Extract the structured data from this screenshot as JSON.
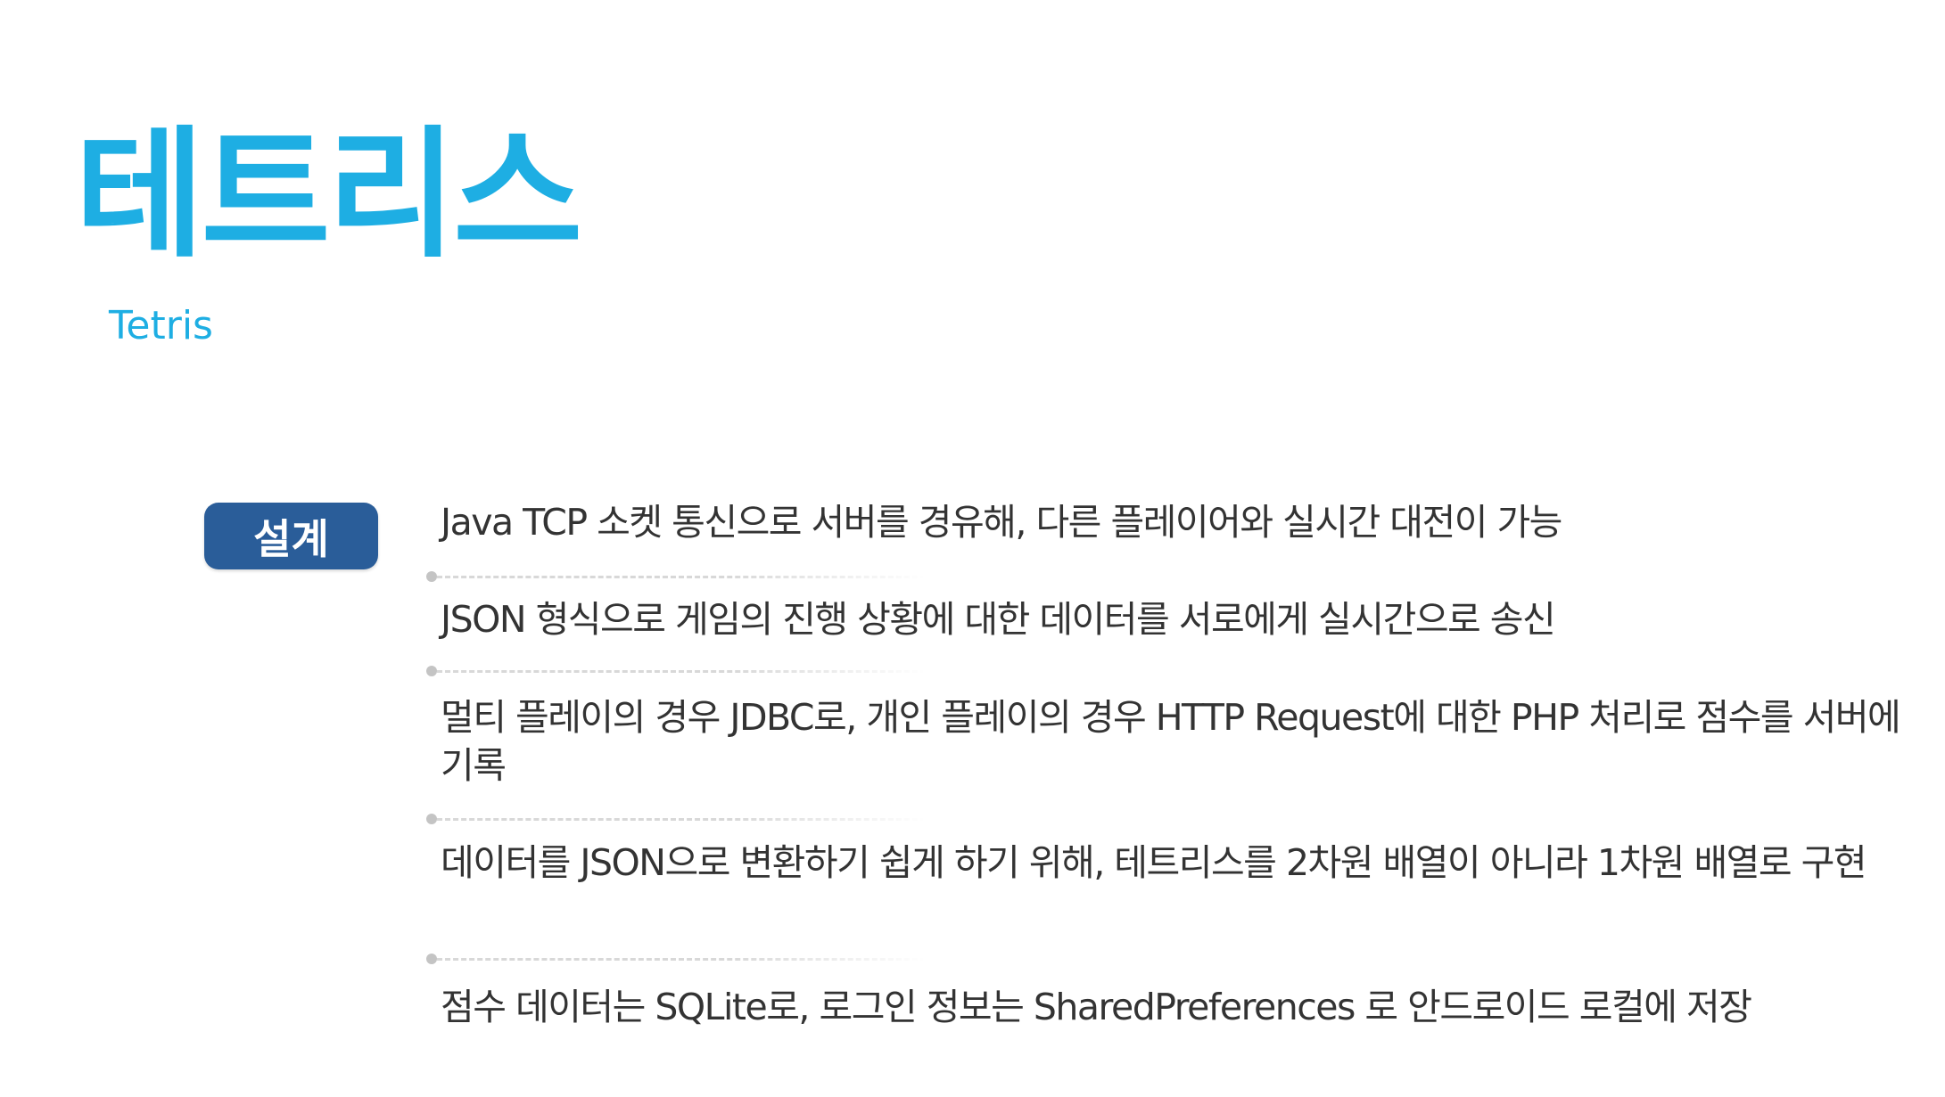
{
  "header": {
    "title": "테트리스",
    "subtitle": "Tetris"
  },
  "section": {
    "badge_label": "설계",
    "items": [
      "Java TCP 소켓 통신으로 서버를 경유해, 다른 플레이어와 실시간 대전이 가능",
      "JSON 형식으로 게임의 진행 상황에 대한 데이터를 서로에게 실시간으로 송신",
      "멀티 플레이의 경우 JDBC로, 개인 플레이의 경우 HTTP Request에 대한 PHP 처리로 점수를 서버에 기록",
      "데이터를 JSON으로 변환하기 쉽게 하기 위해, 테트리스를 2차원 배열이 아니라 1차원 배열로 구현",
      "점수 데이터는 SQLite로, 로그인 정보는 SharedPreferences 로 안드로이드 로컬에 저장"
    ]
  },
  "colors": {
    "title": "#1eaee3",
    "badge_bg": "#2a5d99",
    "body_text": "#333333",
    "divider": "#d8d8d8"
  }
}
